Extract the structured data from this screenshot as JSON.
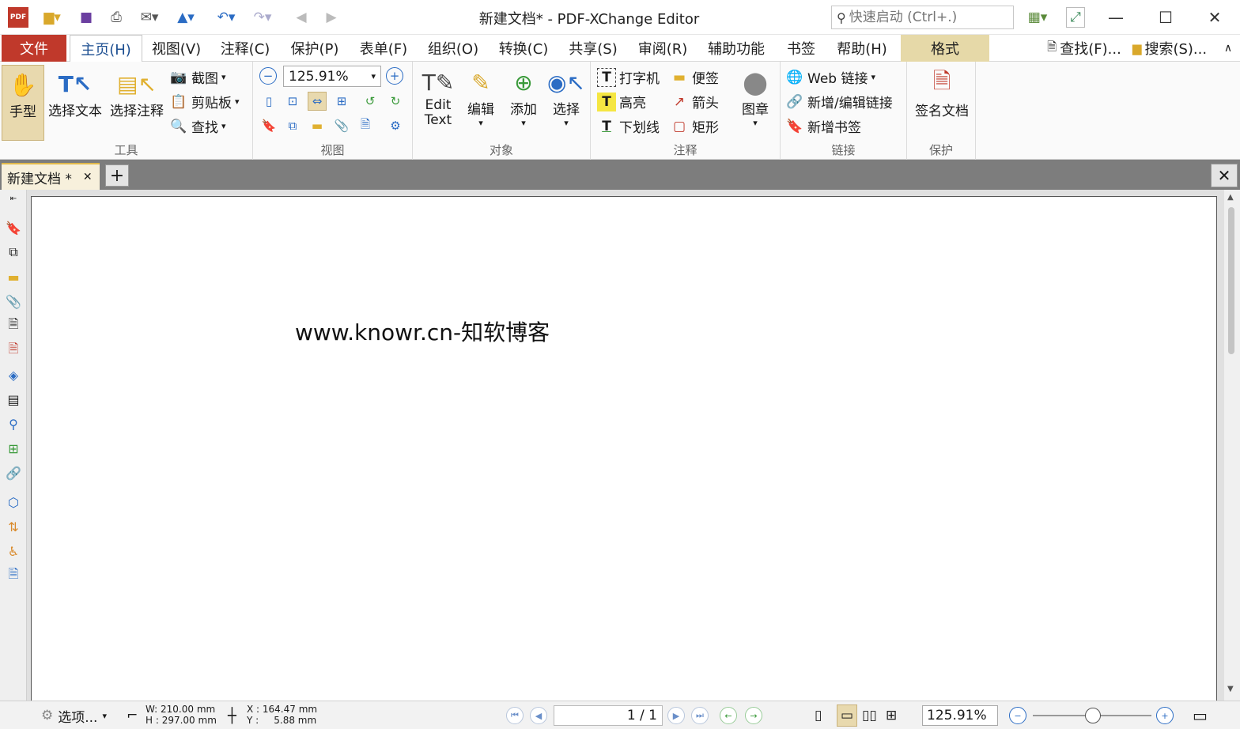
{
  "window": {
    "title": "新建文档* - PDF-XChange Editor",
    "quick_launch_placeholder": "快速启动 (Ctrl+.)",
    "minimize": "—",
    "maximize": "☐",
    "close": "✕"
  },
  "menu": {
    "tabs": [
      "文件",
      "主页(H)",
      "视图(V)",
      "注释(C)",
      "保护(P)",
      "表单(F)",
      "组织(O)",
      "转换(C)",
      "共享(S)",
      "审阅(R)",
      "辅助功能",
      "书签",
      "帮助(H)",
      "格式"
    ],
    "find": "查找(F)...",
    "search": "搜索(S)...",
    "collapse": "∧"
  },
  "ribbon": {
    "tools": {
      "label": "工具",
      "hand": "手型",
      "select_text": "选择文本",
      "select_annot": "选择注释",
      "snapshot": "截图",
      "clipboard": "剪贴板",
      "find": "查找"
    },
    "view": {
      "label": "视图",
      "zoom": "125.91%"
    },
    "objects": {
      "label": "对象",
      "edit_text": "Edit Text",
      "edit": "编辑",
      "add": "添加",
      "select": "选择"
    },
    "annot": {
      "label": "注释",
      "typewriter": "打字机",
      "note": "便签",
      "highlight": "高亮",
      "arrow": "箭头",
      "underline": "下划线",
      "rect": "矩形",
      "stamp": "图章"
    },
    "links": {
      "label": "链接",
      "web": "Web 链接",
      "add_edit": "新增/编辑链接",
      "bookmark": "新增书签"
    },
    "protect": {
      "label": "保护",
      "sign": "签名文档"
    }
  },
  "doc_tab": {
    "name": "新建文档 *",
    "close": "✕",
    "new": "+",
    "close_all": "✕"
  },
  "document": {
    "text": "www.knowr.cn-知软博客"
  },
  "status": {
    "options": "选项...",
    "width": "W: 210.00 mm",
    "height": "H : 297.00 mm",
    "x": "X : 164.47 mm",
    "y": "Y :     5.88 mm",
    "page": "1 / 1",
    "zoom": "125.91%"
  },
  "colors": {
    "file_tab": "#c0392b",
    "format_tab": "#e6d9a8",
    "accent": "#2b6cc4"
  }
}
